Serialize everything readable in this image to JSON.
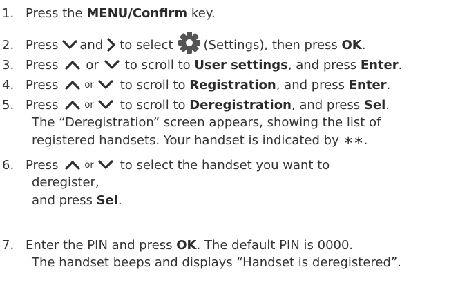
{
  "steps": [
    {
      "number": "1.",
      "parts": [
        "Press the ",
        "MENU/Confirm",
        " key."
      ]
    },
    {
      "number": "2.",
      "parts": [
        "Press",
        "and",
        "to select",
        "(Settings), then press ",
        "OK",
        "."
      ],
      "icons": [
        "chevron-down-icon",
        "chevron-right-icon",
        "gear-icon"
      ]
    },
    {
      "number": "3.",
      "parts": [
        "Press",
        "or",
        "to scroll to ",
        "User settings",
        ", and press ",
        "Enter",
        "."
      ],
      "icons": [
        "chevron-up-icon",
        "chevron-down-icon"
      ]
    },
    {
      "number": "4.",
      "parts": [
        "Press",
        "or",
        "to scroll to ",
        "Registration",
        ", and press ",
        "Enter",
        "."
      ],
      "icons": [
        "chevron-up-icon",
        "chevron-down-icon"
      ]
    },
    {
      "number": "5.",
      "parts": [
        "Press",
        "or",
        "to scroll to ",
        "Deregistration",
        ", and press ",
        "Sel",
        "."
      ],
      "icons": [
        "chevron-up-icon",
        "chevron-down-icon"
      ],
      "note_line1": "The “Deregistration” screen appears, showing the list of",
      "note_line2": "registered handsets. Your handset is indicated by ∗∗."
    },
    {
      "number": "6.",
      "parts": [
        "Press",
        "or",
        "to select the handset you want to"
      ],
      "icons": [
        "chevron-up-icon",
        "chevron-down-icon"
      ],
      "line2": "deregister,",
      "line3_parts": [
        "and press ",
        "Sel",
        "."
      ]
    },
    {
      "number": "7.",
      "parts": [
        "Enter the PIN and press ",
        "OK",
        ". The default PIN is 0000."
      ],
      "note_line1": "The handset beeps and displays “Handset is deregistered”."
    }
  ]
}
